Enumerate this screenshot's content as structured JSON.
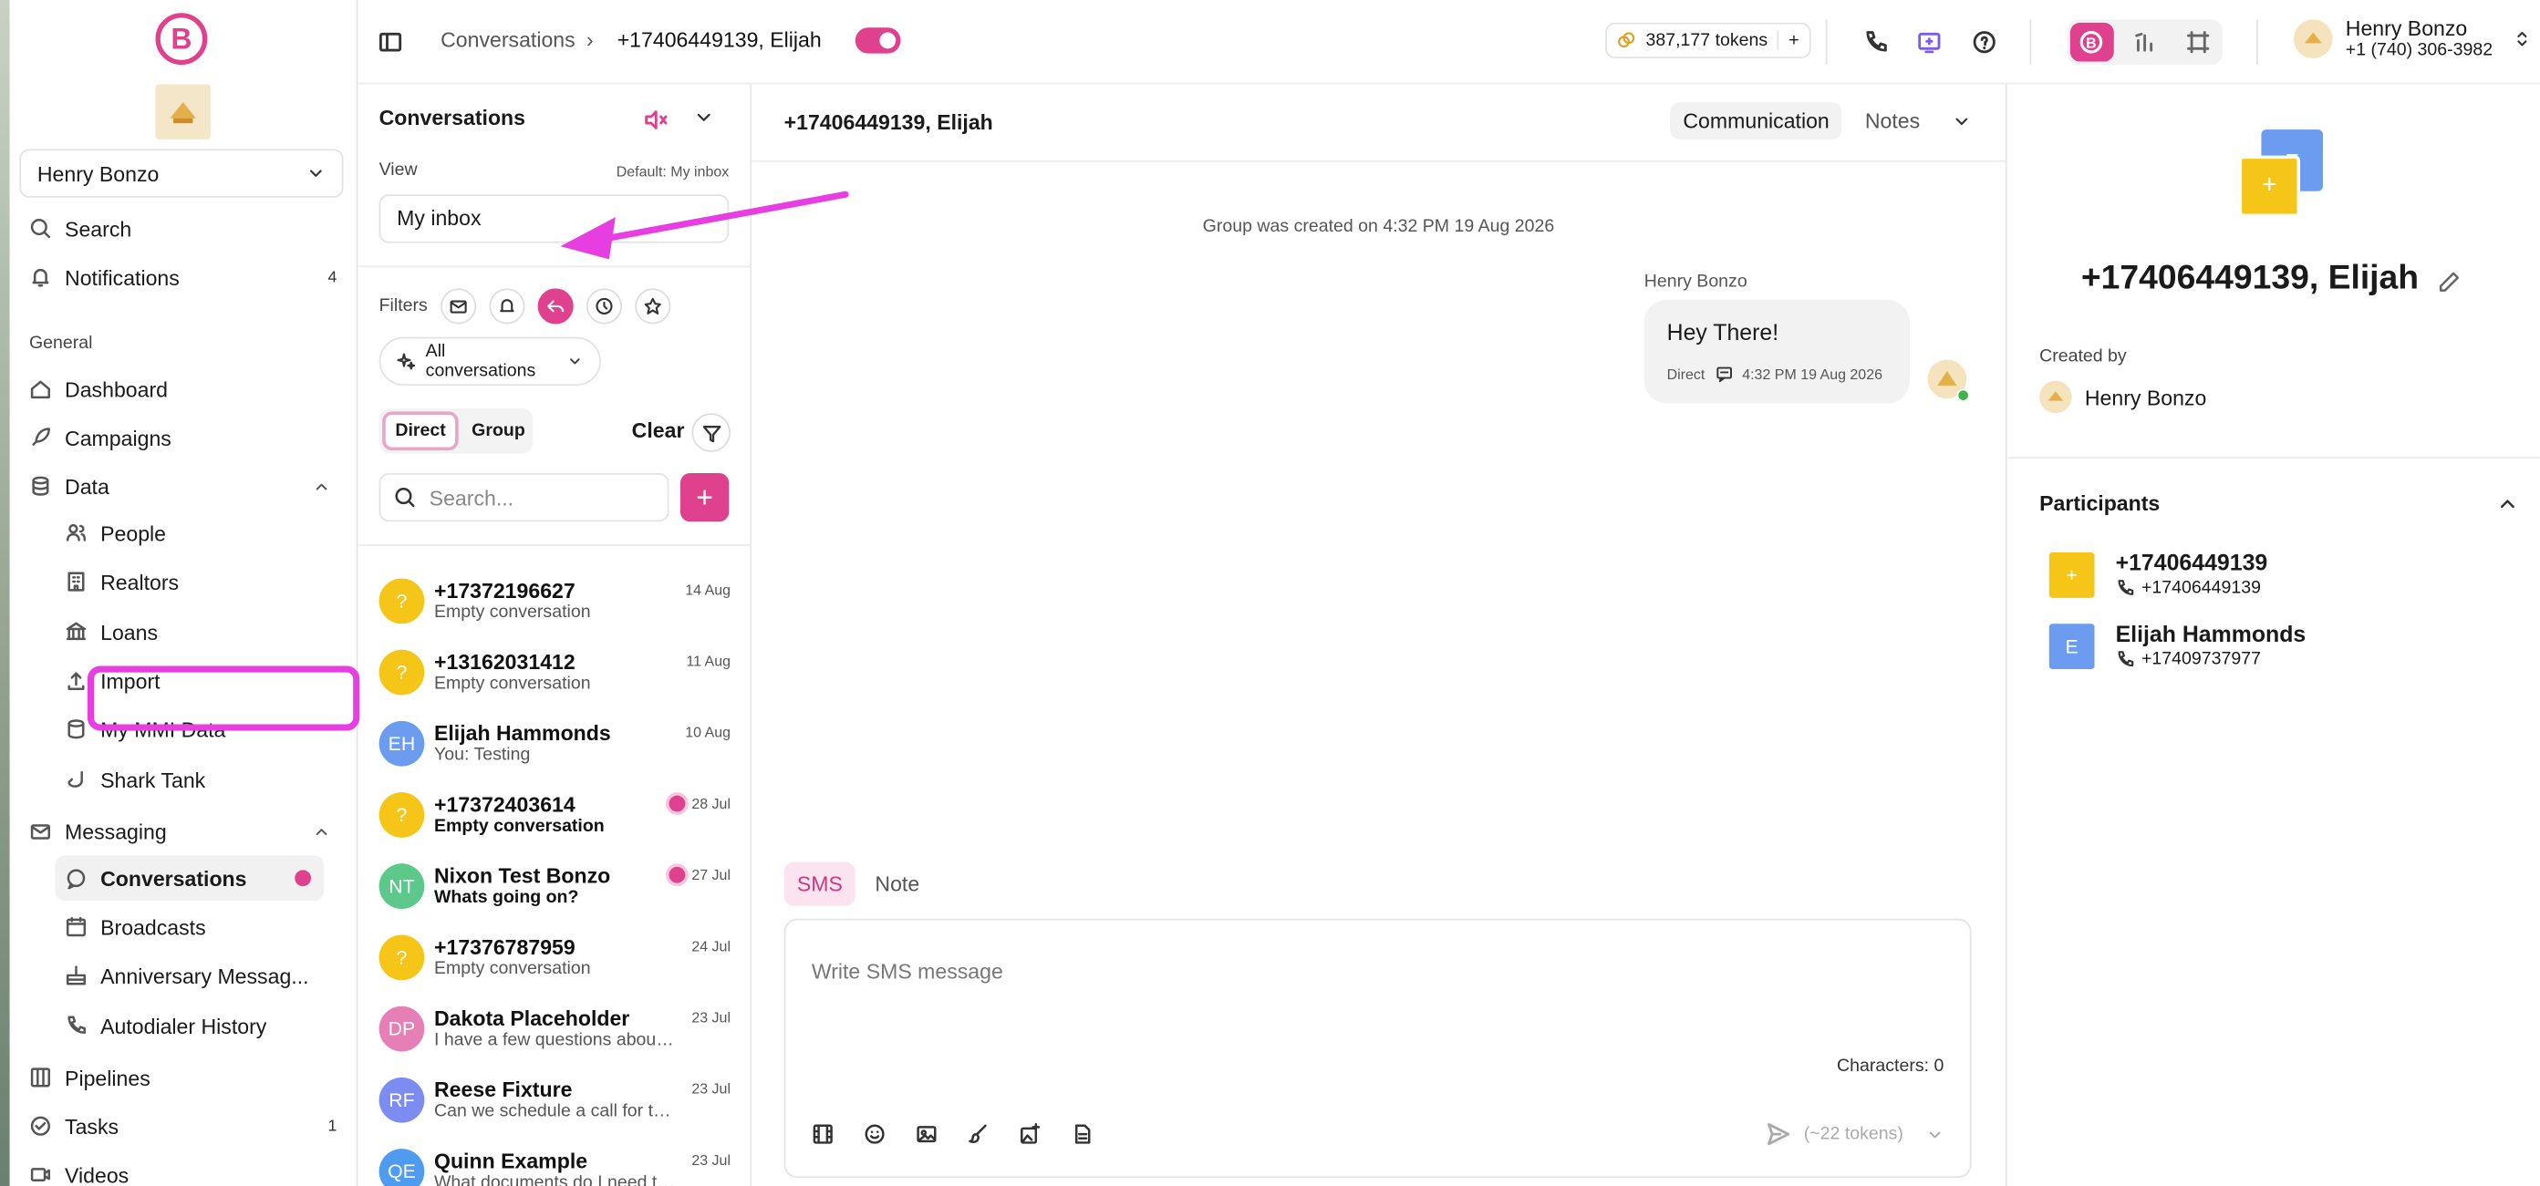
{
  "topbar": {
    "breadcrumb_root": "Conversations",
    "breadcrumb_sep": "›",
    "breadcrumb_current": "+17406449139, Elijah",
    "tokens": "387,177 tokens",
    "tokens_add": "+",
    "user_name": "Henry Bonzo",
    "user_phone": "+1 (740) 306-3982"
  },
  "sidebar": {
    "account": "Henry Bonzo",
    "search": "Search",
    "notifications": "Notifications",
    "notifications_count": "4",
    "section_general": "General",
    "dashboard": "Dashboard",
    "campaigns": "Campaigns",
    "data": "Data",
    "people": "People",
    "realtors": "Realtors",
    "loans": "Loans",
    "import": "Import",
    "my_mmi_data": "My MMI Data",
    "shark_tank": "Shark Tank",
    "messaging": "Messaging",
    "conversations": "Conversations",
    "broadcasts": "Broadcasts",
    "anniversary": "Anniversary Messag...",
    "autodialer": "Autodialer History",
    "pipelines": "Pipelines",
    "tasks": "Tasks",
    "tasks_count": "1",
    "videos": "Videos"
  },
  "convlist": {
    "title": "Conversations",
    "view_label": "View",
    "view_default": "Default: My inbox",
    "view_value": "My inbox",
    "filters_label": "Filters",
    "all_conversations": "All conversations",
    "direct": "Direct",
    "group": "Group",
    "clear": "Clear",
    "search_placeholder": "Search...",
    "items": [
      {
        "initials": "?",
        "name": "+17372196627",
        "preview": "Empty conversation",
        "date": "14 Aug",
        "color": "#f5c518",
        "unread": false
      },
      {
        "initials": "?",
        "name": "+13162031412",
        "preview": "Empty conversation",
        "date": "11 Aug",
        "color": "#f5c518",
        "unread": false
      },
      {
        "initials": "EH",
        "name": "Elijah Hammonds",
        "preview": "You: Testing",
        "date": "10 Aug",
        "color": "#6b9cf0",
        "unread": false
      },
      {
        "initials": "?",
        "name": "+17372403614",
        "preview": "Empty conversation",
        "date": "28 Jul",
        "color": "#f5c518",
        "unread": true
      },
      {
        "initials": "NT",
        "name": "Nixon Test Bonzo",
        "preview": "Whats going on?",
        "date": "27 Jul",
        "color": "#5cc98a",
        "unread": true
      },
      {
        "initials": "?",
        "name": "+17376787959",
        "preview": "Empty conversation",
        "date": "24 Jul",
        "color": "#f5c518",
        "unread": false
      },
      {
        "initials": "DP",
        "name": "Dakota Placeholder",
        "preview": "I have a few questions about ...",
        "date": "23 Jul",
        "color": "#e77fb7",
        "unread": false
      },
      {
        "initials": "RF",
        "name": "Reese Fixture",
        "preview": "Can we schedule a call for to...",
        "date": "23 Jul",
        "color": "#7c8cf0",
        "unread": false
      },
      {
        "initials": "QE",
        "name": "Quinn Example",
        "preview": "What documents do I need to ...",
        "date": "23 Jul",
        "color": "#4f9bf0",
        "unread": false
      }
    ]
  },
  "chat": {
    "title": "+17406449139, Elijah",
    "tab_communication": "Communication",
    "tab_notes": "Notes",
    "system_message": "Group was created on 4:32 PM 19 Aug 2026",
    "sender": "Henry Bonzo",
    "message_text": "Hey There!",
    "message_channel": "Direct",
    "message_time": "4:32 PM 19 Aug 2026",
    "composer_tab_sms": "SMS",
    "composer_tab_note": "Note",
    "composer_placeholder": "Write SMS message",
    "characters": "Characters: 0",
    "send_tokens": "(~22 tokens)"
  },
  "details": {
    "group_initial": "E",
    "group_plus": "+",
    "title": "+17406449139, Elijah",
    "created_by_label": "Created by",
    "created_by": "Henry Bonzo",
    "participants_title": "Participants",
    "participants": [
      {
        "initial": "+",
        "name": "+17406449139",
        "phone": "+17406449139",
        "color": "#f5c518"
      },
      {
        "initial": "E",
        "name": "Elijah Hammonds",
        "phone": "+17409737977",
        "color": "#6b9cf0"
      }
    ]
  },
  "colors": {
    "brand_pink": "#e0418f",
    "annotation_magenta": "#e63ee0"
  }
}
